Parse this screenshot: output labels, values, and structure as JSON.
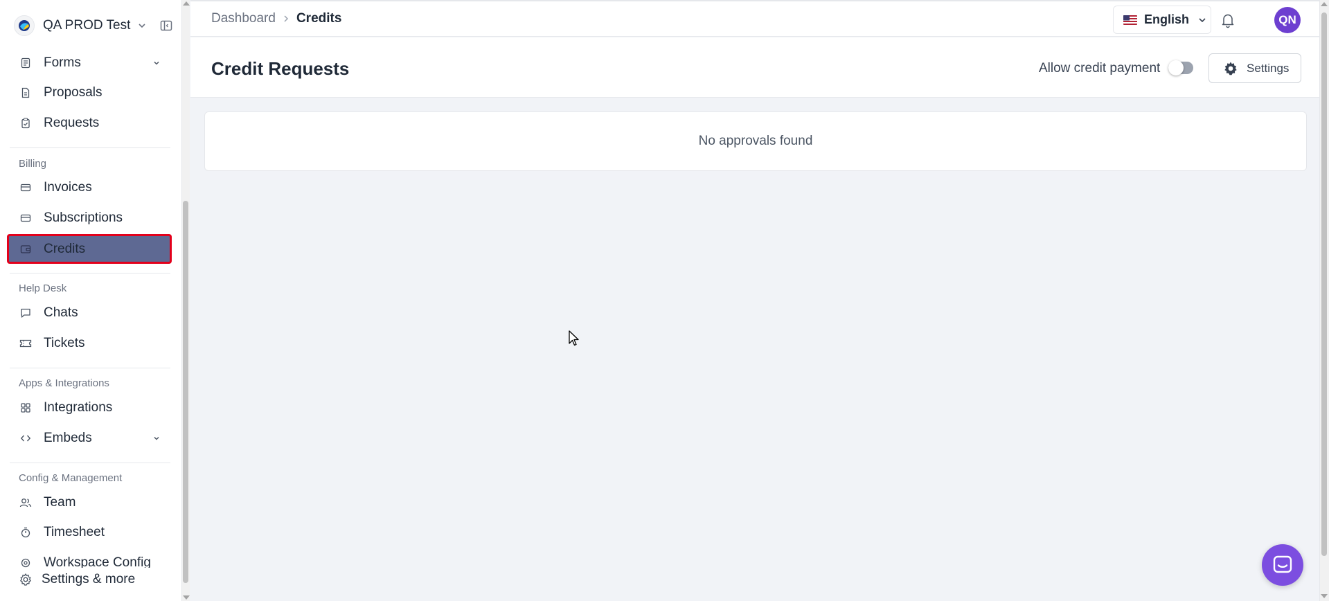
{
  "workspace": {
    "name": "QA PROD Test"
  },
  "sidebar": {
    "items": [
      {
        "label": "Forms",
        "icon": "form-icon",
        "has_caret": true
      },
      {
        "label": "Proposals",
        "icon": "document-icon"
      },
      {
        "label": "Requests",
        "icon": "clipboard-check-icon"
      }
    ],
    "billing": {
      "label": "Billing",
      "items": [
        {
          "label": "Invoices",
          "icon": "credit-card-icon"
        },
        {
          "label": "Subscriptions",
          "icon": "credit-card-icon"
        },
        {
          "label": "Credits",
          "icon": "wallet-icon",
          "active": true
        }
      ]
    },
    "helpdesk": {
      "label": "Help Desk",
      "items": [
        {
          "label": "Chats",
          "icon": "chat-bubble-icon"
        },
        {
          "label": "Tickets",
          "icon": "ticket-icon"
        }
      ]
    },
    "apps": {
      "label": "Apps & Integrations",
      "items": [
        {
          "label": "Integrations",
          "icon": "grid-icon"
        },
        {
          "label": "Embeds",
          "icon": "code-icon",
          "has_caret": true
        }
      ]
    },
    "config": {
      "label": "Config & Management",
      "items": [
        {
          "label": "Team",
          "icon": "users-icon"
        },
        {
          "label": "Timesheet",
          "icon": "stopwatch-icon"
        },
        {
          "label": "Workspace Config",
          "icon": "workspace-gear-icon"
        }
      ]
    },
    "footer": {
      "label": "Settings & more",
      "icon": "gear-icon"
    }
  },
  "topbar": {
    "breadcrumb": [
      "Dashboard",
      "Credits"
    ],
    "language": "English",
    "avatar_initials": "QN"
  },
  "page": {
    "title": "Credit Requests",
    "allow_credit_payment_label": "Allow credit payment",
    "allow_credit_payment": false,
    "settings_label": "Settings",
    "empty_message": "No approvals found"
  },
  "colors": {
    "active_bg": "#5e6993",
    "active_outline": "#e3001b",
    "avatar_bg": "#6d3fd0",
    "launcher_bg": "#7c4ee0",
    "page_bg": "#f1f3f7"
  }
}
